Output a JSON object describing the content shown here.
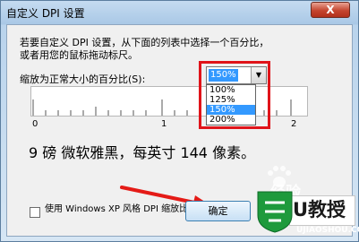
{
  "window": {
    "title": "自定义 DPI 设置",
    "close_label": "X"
  },
  "description": "若要自定义 DPI 设置，从下面的列表中选择一个百分比，\n或者用您的鼠标拖动标尺。",
  "scale": {
    "label": "缩放为正常大小的百分比(S):",
    "selected": "150%",
    "options": [
      "100%",
      "125%",
      "150%",
      "200%"
    ]
  },
  "ruler": {
    "labels": [
      "0",
      "1",
      "2"
    ]
  },
  "sample_text": "9 磅 微软雅黑，每英寸 144 像素。",
  "checkbox": {
    "label": "使用 Windows XP 风格 DPI 缩放比例(X)",
    "checked": false
  },
  "buttons": {
    "ok": "确定"
  },
  "watermark": {
    "brand": "U教授",
    "domain": "UJIAOSHOU.COM",
    "site": "经验"
  },
  "colors": {
    "highlight": "#3399ff",
    "annotation_red": "#e0141a",
    "arrow_red": "#e41b17"
  }
}
